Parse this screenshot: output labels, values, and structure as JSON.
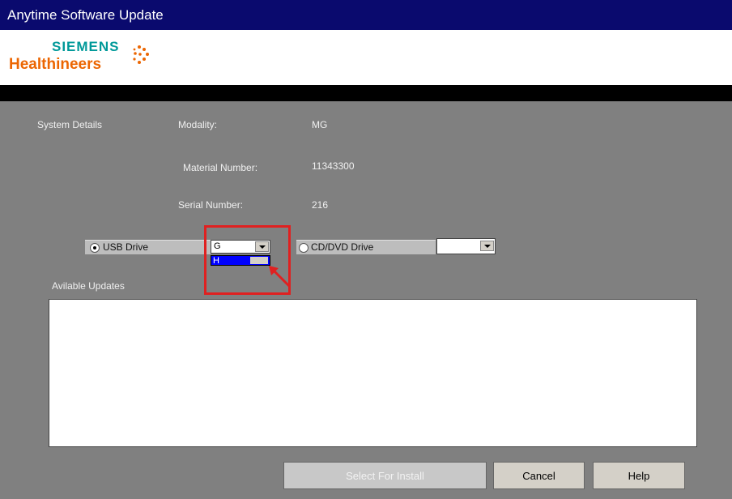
{
  "window": {
    "title": "Anytime Software Update"
  },
  "logo": {
    "line1": "SIEMENS",
    "line2": "Healthineers"
  },
  "system": {
    "section_label": "System Details",
    "modality_label": "Modality:",
    "modality_value": "MG",
    "material_label": "Material Number:",
    "material_value": "11343300",
    "serial_label": "Serial Number:",
    "serial_value": "216"
  },
  "source": {
    "usb_label": "USB Drive",
    "usb_selected": true,
    "usb_drive_value": "G",
    "usb_dropdown_option": "H",
    "cd_label": "CD/DVD Drive",
    "cd_selected": false,
    "cd_drive_value": ""
  },
  "updates": {
    "label": "Avilable Updates",
    "items": []
  },
  "buttons": {
    "select": "Select For Install",
    "cancel": "Cancel",
    "help": "Help"
  },
  "colors": {
    "titlebar": "#0a0a6e",
    "logo_teal": "#009999",
    "logo_orange": "#ec6602",
    "highlight": "#e02020",
    "background": "#808080"
  }
}
